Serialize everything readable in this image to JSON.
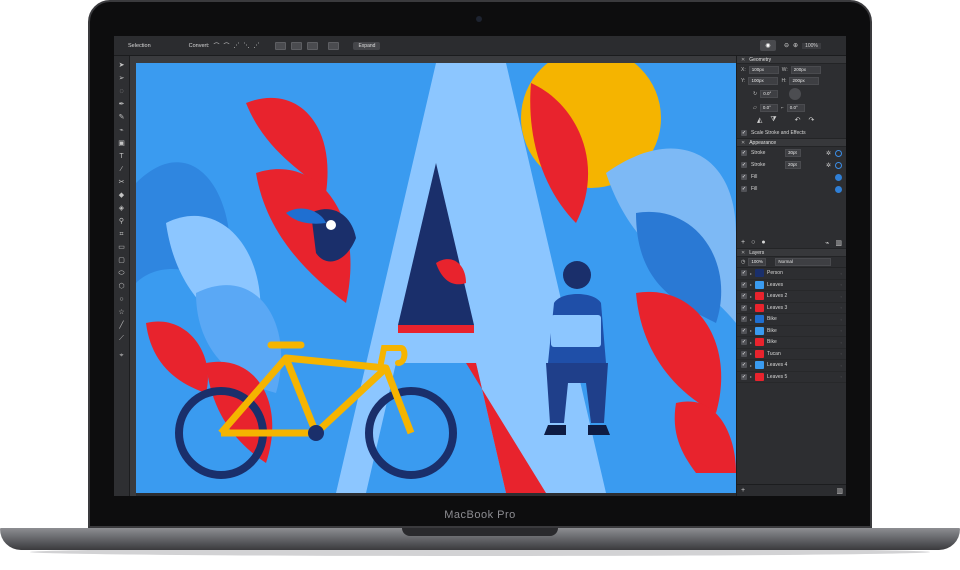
{
  "device": {
    "label": "MacBook Pro"
  },
  "toolbar": {
    "mode": "Selection",
    "convert_label": "Convert:",
    "expand_label": "Expand",
    "zoom_value": "100%",
    "icons": [
      "eye-icon",
      "zoom-out-icon",
      "zoom-in-icon"
    ]
  },
  "tools": [
    "move-icon",
    "node-icon",
    "lasso-icon",
    "pen-icon",
    "pencil-icon",
    "brush-icon",
    "image-icon",
    "text-icon",
    "eyedropper-icon",
    "scissors-icon",
    "eraser-icon",
    "fill-icon",
    "picker-icon",
    "crop-icon",
    "rectangle-icon",
    "rounded-rectangle-icon",
    "ellipse-icon",
    "polygon-icon",
    "circle-icon",
    "star-icon",
    "line-icon",
    "knife-icon",
    "artboard-icon"
  ],
  "geometry": {
    "title": "Geometry",
    "x_label": "X:",
    "x_value": "100px",
    "w_label": "W:",
    "w_value": "200px",
    "y_label": "Y:",
    "y_value": "100px",
    "h_label": "H:",
    "h_value": "200px",
    "rotate_value": "0.0°",
    "shear_value": "0.0°",
    "corner_value": "0.0°",
    "scale_label": "Scale Stroke and Effects"
  },
  "appearance": {
    "title": "Appearance",
    "rows": [
      {
        "label": "Stroke",
        "value": "30pt"
      },
      {
        "label": "Stroke",
        "value": "20pt"
      },
      {
        "label": "Fill",
        "value": ""
      },
      {
        "label": "Fill",
        "value": ""
      }
    ]
  },
  "layers": {
    "title": "Layers",
    "opacity": "100%",
    "blend": "Normal",
    "items": [
      "Person",
      "Leaves",
      "Leaves 2",
      "Leaves 3",
      "Bike",
      "Bike",
      "Bike",
      "Tucan",
      "Leaves 4",
      "Leaves 5"
    ]
  },
  "colors": {
    "canvas_bg": "#3a9bf0",
    "red": "#e8232d",
    "yellow": "#f5b400",
    "navy": "#1a2f6b",
    "light_blue": "#8cc6ff",
    "accent": "#3b8ee8"
  }
}
